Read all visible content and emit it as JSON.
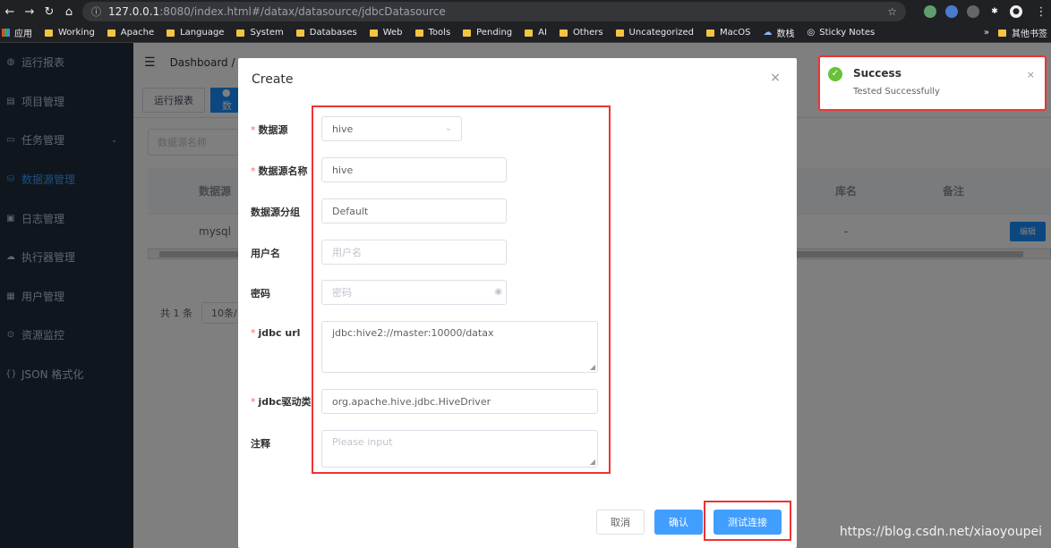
{
  "browser": {
    "url_host": "127.0.0.1",
    "url_path": ":8080/index.html#/datax/datasource/jdbcDatasource",
    "bookmarks": [
      "应用",
      "Working",
      "Apache",
      "Language",
      "System",
      "Databases",
      "Web",
      "Tools",
      "Pending",
      "AI",
      "Others",
      "Uncategorized",
      "MacOS",
      "数栈",
      "Sticky Notes"
    ],
    "other_bookmarks": "其他书签"
  },
  "sidebar": {
    "items": [
      {
        "label": "运行报表",
        "icon": "dashboard-icon"
      },
      {
        "label": "项目管理",
        "icon": "project-icon"
      },
      {
        "label": "任务管理",
        "icon": "task-icon"
      },
      {
        "label": "数据源管理",
        "icon": "datasource-icon"
      },
      {
        "label": "日志管理",
        "icon": "log-icon"
      },
      {
        "label": "执行器管理",
        "icon": "executor-icon"
      },
      {
        "label": "用户管理",
        "icon": "user-icon"
      },
      {
        "label": "资源监控",
        "icon": "monitor-icon"
      },
      {
        "label": "JSON 格式化",
        "icon": "json-icon"
      }
    ],
    "active_index": 3
  },
  "navbar": {
    "breadcrumb": "Dashboard / "
  },
  "tags": {
    "first": "运行报表",
    "second": "● 数"
  },
  "filter_placeholder": "数据源名称",
  "table": {
    "headers": [
      "数据源",
      "库名",
      "备注"
    ],
    "row": {
      "datasource": "mysql",
      "dbname": "-",
      "op": "编辑"
    }
  },
  "pager": {
    "total": "共 1 条",
    "size": "10条/"
  },
  "dialog": {
    "title": "Create",
    "close": "×",
    "fields": {
      "datasource": {
        "label": "数据源",
        "value": "hive"
      },
      "name": {
        "label": "数据源名称",
        "value": "hive"
      },
      "group": {
        "label": "数据源分组",
        "value": "Default"
      },
      "username": {
        "label": "用户名",
        "placeholder": "用户名"
      },
      "password": {
        "label": "密码",
        "placeholder": "密码"
      },
      "jdbc_url": {
        "label": "jdbc url",
        "value": "jdbc:hive2://master:10000/datax"
      },
      "jdbc_driver": {
        "label": "jdbc驱动类",
        "value": "org.apache.hive.jdbc.HiveDriver"
      },
      "comment": {
        "label": "注释",
        "placeholder": "Please input"
      }
    },
    "buttons": {
      "cancel": "取消",
      "confirm": "确认",
      "test": "测试连接"
    }
  },
  "notification": {
    "title": "Success",
    "message": "Tested Successfully",
    "close": "×"
  },
  "watermark": "https://blog.csdn.net/xiaoyoupei",
  "colors": {
    "primary": "#409eff",
    "success": "#67c23a",
    "sidebar_bg": "#1f2d3d",
    "annotation": "#e33333"
  }
}
